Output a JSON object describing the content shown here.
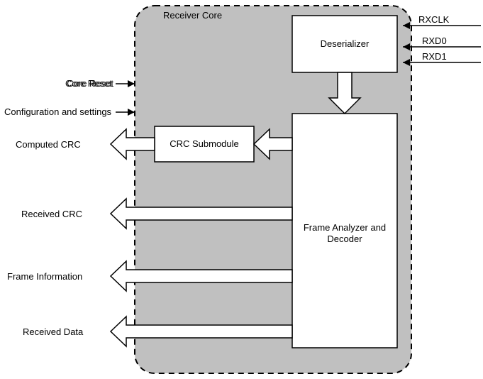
{
  "core": {
    "title": "Receiver Core"
  },
  "blocks": {
    "deserializer": "Deserializer",
    "crc": "CRC Submodule",
    "decoder_l1": "Frame Analyzer and",
    "decoder_l2": "Decoder"
  },
  "inputs_right": {
    "rxclk": "RXCLK",
    "rxd0": "RXD0",
    "rxd1": "RXD1"
  },
  "inputs_left": {
    "core_reset": "Core Reset",
    "config": "Configuration and settings"
  },
  "outputs_left": {
    "computed_crc": "Computed CRC",
    "received_crc": "Received CRC",
    "frame_info": "Frame Information",
    "received_data": "Received Data"
  }
}
